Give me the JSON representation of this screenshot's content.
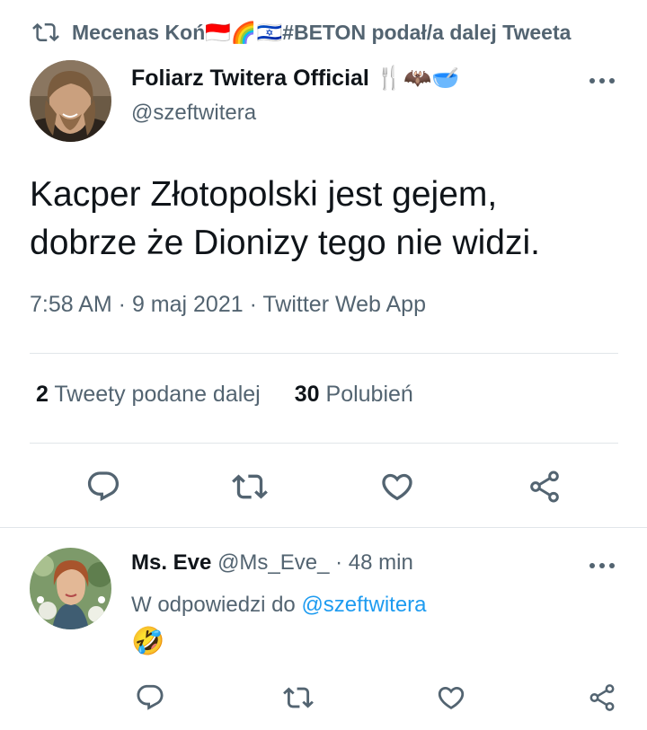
{
  "retweet_context": {
    "icon": "retweet-icon",
    "text": "Mecenas Koń🇮🇩🌈🇮🇱#BETON podał/a dalej Tweeta"
  },
  "tweet": {
    "author_name": "Foliarz Twitera Official",
    "author_emojis": "🍴🦇🥣",
    "handle": "@szeftwitera",
    "text_line1": "Kacper Złotopolski jest gejem,",
    "text_line2": "dobrze że Dionizy tego nie widzi.",
    "meta": "7:58 AM · 9 maj 2021 · Twitter Web App",
    "stats": {
      "retweets_count": "2",
      "retweets_label": "Tweety podane dalej",
      "likes_count": "30",
      "likes_label": "Polubień"
    },
    "more_icon": "more-icon"
  },
  "reply": {
    "author_name": "Ms. Eve",
    "handle_time": "@Ms_Eve_ · 48 min",
    "reply_prefix": "W odpowiedzi do",
    "reply_target": "@szeftwitera",
    "text": "🤣"
  },
  "actions": [
    "reply-icon",
    "retweet-icon",
    "like-icon",
    "share-icon"
  ],
  "colors": {
    "text_primary": "#0f1419",
    "text_secondary": "#536471",
    "link": "#1d9bf0",
    "divider": "#e1e6ea"
  }
}
